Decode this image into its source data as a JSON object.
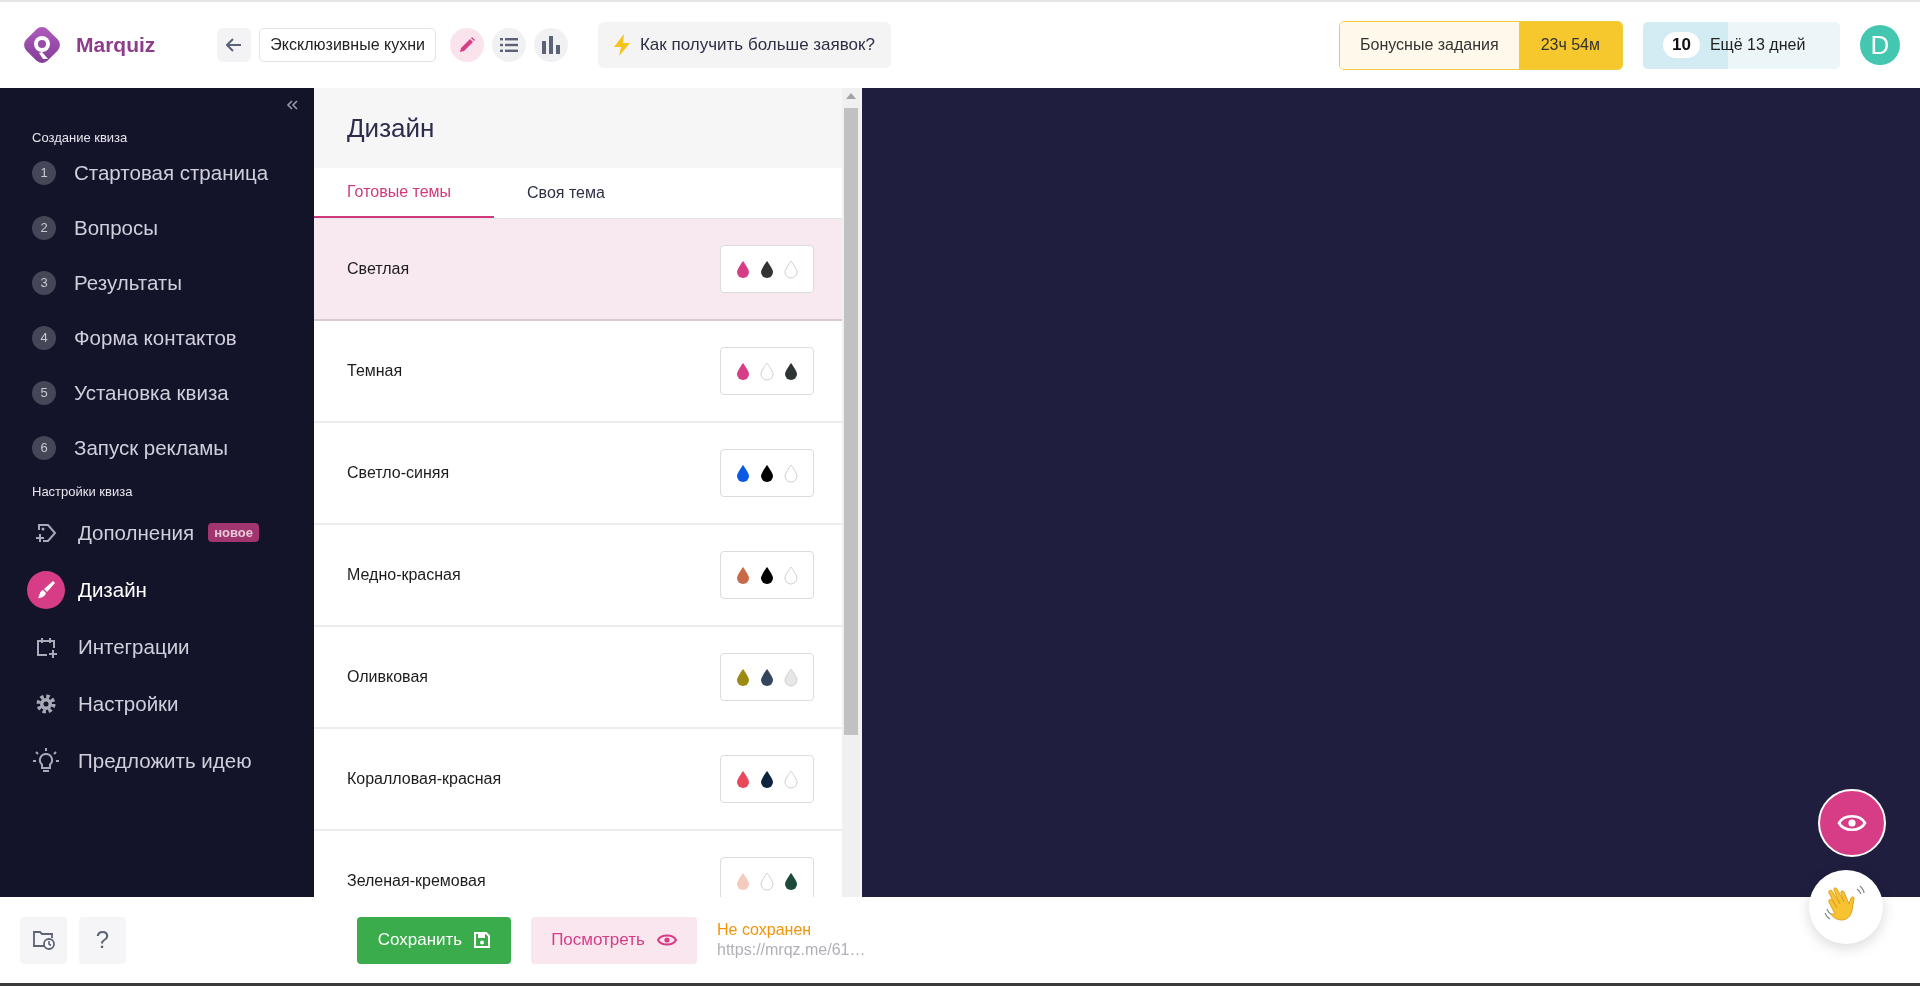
{
  "header": {
    "logo": "Marquiz",
    "quiz_name": "Эксклюзивные кухни",
    "modes": [
      {
        "kind": "edit",
        "selected": true
      },
      {
        "kind": "list",
        "selected": false
      },
      {
        "kind": "stats",
        "selected": false
      }
    ],
    "tip": "Как получить больше заявок?",
    "bonus": {
      "label": "Бонусные задания",
      "timer": "23ч 54м"
    },
    "trial": {
      "count": "10",
      "label": "Ещё 13 дней",
      "level": 0.43
    },
    "avatar": "D"
  },
  "sidebar": {
    "sections": [
      {
        "title": "Создание квиза",
        "items": [
          {
            "kind": "step",
            "number": "1",
            "label": "Стартовая страница",
            "selected": false
          },
          {
            "kind": "step",
            "number": "2",
            "label": "Вопросы",
            "selected": false
          },
          {
            "kind": "step",
            "number": "3",
            "label": "Результаты",
            "selected": false
          },
          {
            "kind": "step",
            "number": "4",
            "label": "Форма контактов",
            "selected": false
          },
          {
            "kind": "step",
            "number": "5",
            "label": "Установка квиза",
            "selected": false
          },
          {
            "kind": "step",
            "number": "6",
            "label": "Запуск рекламы",
            "selected": false
          }
        ]
      },
      {
        "title": "Настройки квиза",
        "items": [
          {
            "kind": "addons",
            "label": "Дополнения",
            "badge": "новое",
            "selected": false
          },
          {
            "kind": "design",
            "label": "Дизайн",
            "selected": true
          },
          {
            "kind": "integrations",
            "label": "Интеграции",
            "selected": false
          },
          {
            "kind": "settings",
            "label": "Настройки",
            "selected": false
          },
          {
            "kind": "idea",
            "label": "Предложить идею",
            "selected": false
          }
        ]
      }
    ]
  },
  "design": {
    "title": "Дизайн",
    "tabs": [
      {
        "label": "Готовые темы",
        "selected": true
      },
      {
        "label": "Своя тема",
        "selected": false
      }
    ],
    "themes": [
      {
        "name": "Светлая",
        "selected": true,
        "swatches": [
          {
            "color": "#d63d86"
          },
          {
            "color": "#333333"
          },
          {
            "color": "#ffffff"
          }
        ]
      },
      {
        "name": "Темная",
        "selected": false,
        "swatches": [
          {
            "color": "#d63d86"
          },
          {
            "color": "#ffffff"
          },
          {
            "color": "#2f3436"
          }
        ]
      },
      {
        "name": "Светло-синяя",
        "selected": false,
        "swatches": [
          {
            "color": "#0a5ae6"
          },
          {
            "color": "#000000"
          },
          {
            "color": "#ffffff"
          }
        ]
      },
      {
        "name": "Медно-красная",
        "selected": false,
        "swatches": [
          {
            "color": "#c8694a"
          },
          {
            "color": "#000000"
          },
          {
            "color": "#ffffff"
          }
        ]
      },
      {
        "name": "Оливковая",
        "selected": false,
        "swatches": [
          {
            "color": "#9c8a12"
          },
          {
            "color": "#34465e"
          },
          {
            "color": "#e8e6e4"
          }
        ]
      },
      {
        "name": "Коралловая-красная",
        "selected": false,
        "swatches": [
          {
            "color": "#e8495a"
          },
          {
            "color": "#0e2340"
          },
          {
            "color": "#ffffff"
          }
        ]
      },
      {
        "name": "Зеленая-кремовая",
        "selected": false,
        "swatches": [
          {
            "color": "#f5cbbf"
          },
          {
            "color": "#ffffff"
          },
          {
            "color": "#1e4a3c"
          }
        ]
      }
    ]
  },
  "footer": {
    "help": "?",
    "save": "Сохранить",
    "preview": "Посмотреть",
    "status": "Не сохранен",
    "url": "https://mrqz.me/61…"
  }
}
